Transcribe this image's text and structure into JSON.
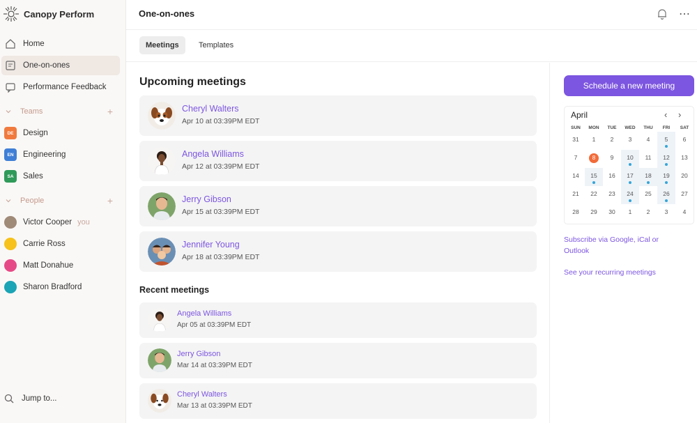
{
  "app": {
    "name": "Canopy Perform"
  },
  "sidebar": {
    "nav": [
      {
        "label": "Home",
        "icon": "home-icon"
      },
      {
        "label": "One-on-ones",
        "icon": "one-on-ones-icon"
      },
      {
        "label": "Performance Feedback",
        "icon": "feedback-icon"
      }
    ],
    "teams_label": "Teams",
    "teams": [
      {
        "badge": "DE",
        "label": "Design",
        "color": "#f07a3e"
      },
      {
        "badge": "EN",
        "label": "Engineering",
        "color": "#3f7fd6"
      },
      {
        "badge": "SA",
        "label": "Sales",
        "color": "#2f9a5a"
      }
    ],
    "people_label": "People",
    "people": [
      {
        "label": "Victor Cooper",
        "color": "#a08a78",
        "you": "you"
      },
      {
        "label": "Carrie Ross",
        "color": "#f6c21b"
      },
      {
        "label": "Matt Donahue",
        "color": "#e64a86"
      },
      {
        "label": "Sharon Bradford",
        "color": "#1aa4b5"
      }
    ],
    "jump_label": "Jump to..."
  },
  "header": {
    "title": "One-on-ones"
  },
  "tabs": [
    {
      "label": "Meetings"
    },
    {
      "label": "Templates"
    }
  ],
  "main": {
    "upcoming_title": "Upcoming meetings",
    "upcoming": [
      {
        "name": "Cheryl Walters",
        "time": "Apr 10 at 03:39PM EDT",
        "avatar": "dog"
      },
      {
        "name": "Angela Williams",
        "time": "Apr 12 at 03:39PM EDT",
        "avatar": "woman"
      },
      {
        "name": "Jerry Gibson",
        "time": "Apr 15 at 03:39PM EDT",
        "avatar": "man"
      },
      {
        "name": "Jennifer Young",
        "time": "Apr 18 at 03:39PM EDT",
        "avatar": "group"
      }
    ],
    "recent_title": "Recent meetings",
    "recent": [
      {
        "name": "Angela Williams",
        "time": "Apr 05 at 03:39PM EDT",
        "avatar": "woman"
      },
      {
        "name": "Jerry Gibson",
        "time": "Mar 14 at 03:39PM EDT",
        "avatar": "man"
      },
      {
        "name": "Cheryl Walters",
        "time": "Mar 13 at 03:39PM EDT",
        "avatar": "dog"
      }
    ]
  },
  "right": {
    "schedule_label": "Schedule a new meeting",
    "calendar": {
      "month": "April",
      "prev": "‹",
      "next": "›",
      "dow": [
        "SUN",
        "MON",
        "TUE",
        "WED",
        "THU",
        "FRI",
        "SAT"
      ],
      "weeks": [
        [
          "31",
          "1",
          "2",
          "3",
          "4",
          "5",
          "6"
        ],
        [
          "7",
          "8",
          "9",
          "10",
          "11",
          "12",
          "13"
        ],
        [
          "14",
          "15",
          "16",
          "17",
          "18",
          "19",
          "20"
        ],
        [
          "21",
          "22",
          "23",
          "24",
          "25",
          "26",
          "27"
        ],
        [
          "28",
          "29",
          "30",
          "1",
          "2",
          "3",
          "4"
        ]
      ],
      "today": "8",
      "meeting_days": [
        "5",
        "10",
        "12",
        "15",
        "17",
        "18",
        "19",
        "24",
        "26"
      ],
      "dot_color": "#36a5d8",
      "today_color": "#f26b3a"
    },
    "subscribe_text": "Subscribe via Google, iCal or Outlook",
    "recurring_text": "See your recurring meetings"
  },
  "colors": {
    "accent": "#7c55e0",
    "sidebar_bg": "#faf8f6",
    "card_bg": "#f4f4f4"
  }
}
